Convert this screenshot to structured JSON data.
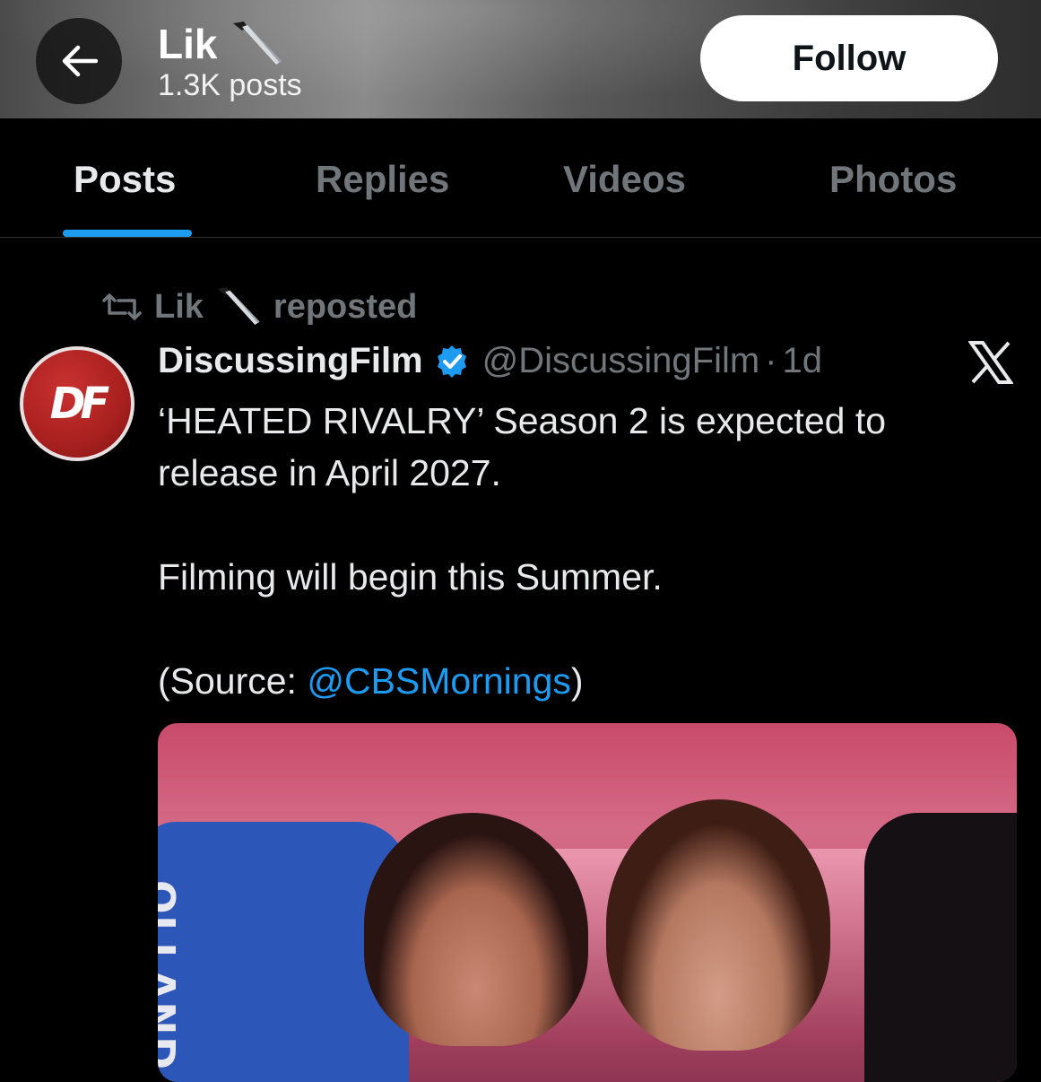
{
  "header": {
    "back_icon": "arrow-left-icon",
    "name": "Lik",
    "name_emoji": "knife-icon",
    "post_count": "1.3K posts",
    "follow_label": "Follow"
  },
  "tabs": [
    {
      "label": "Posts",
      "active": true
    },
    {
      "label": "Replies",
      "active": false
    },
    {
      "label": "Videos",
      "active": false
    },
    {
      "label": "Photos",
      "active": false
    }
  ],
  "post": {
    "repost": {
      "icon": "repost-icon",
      "user": "Lik",
      "emoji": "knife-icon",
      "label": "reposted"
    },
    "author": {
      "name": "DiscussingFilm",
      "verified": true,
      "handle": "@DiscussingFilm",
      "separator": "·",
      "time": "1d",
      "avatar_text": "DF"
    },
    "text": {
      "line1": "‘HEATED RIVALRY’ Season 2 is expected to release in April 2027.",
      "line2": "Filming will begin this Summer.",
      "source_prefix": "(Source: ",
      "source_mention": "@CBSMornings",
      "source_suffix": ")"
    },
    "media": {
      "jersey_text": "OLLAND"
    },
    "platform_icon": "x-logo-icon"
  },
  "colors": {
    "accent": "#1d9bf0",
    "muted": "#71767b",
    "text": "#e7e9ea",
    "background": "#000000"
  }
}
